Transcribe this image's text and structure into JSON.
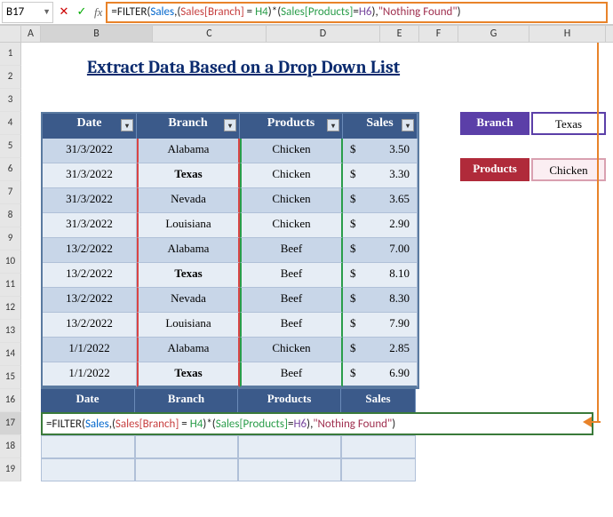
{
  "cellref": "B17",
  "formula": {
    "eq": "=",
    "fn": "FILTER",
    "p1": "(",
    "sales": "Sales",
    "c1": ",(",
    "branchcol": "Sales[Branch]",
    "eq2": " = ",
    "h4": "H4",
    "mid": ")*(",
    "prodcol": "Sales[Products]",
    "eq3": "=",
    "h6": "H6",
    "end": "),",
    "str": "\"Nothing Found\"",
    "close": ")"
  },
  "cols": [
    "A",
    "B",
    "C",
    "D",
    "E",
    "F",
    "G",
    "H"
  ],
  "rows": [
    "1",
    "2",
    "3",
    "4",
    "5",
    "6",
    "7",
    "8",
    "9",
    "10",
    "11",
    "12",
    "13",
    "14",
    "15",
    "16",
    "17",
    "18",
    "19"
  ],
  "title": "Extract Data Based on a Drop Down List",
  "headers": {
    "date": "Date",
    "branch": "Branch",
    "products": "Products",
    "sales": "Sales"
  },
  "data": [
    {
      "date": "31/3/2022",
      "branch": "Alabama",
      "product": "Chicken",
      "cur": "$",
      "sales": "3.50"
    },
    {
      "date": "31/3/2022",
      "branch": "Texas",
      "product": "Chicken",
      "cur": "$",
      "sales": "3.30",
      "bold": true
    },
    {
      "date": "31/3/2022",
      "branch": "Nevada",
      "product": "Chicken",
      "cur": "$",
      "sales": "3.65"
    },
    {
      "date": "31/3/2022",
      "branch": "Louisiana",
      "product": "Chicken",
      "cur": "$",
      "sales": "2.90"
    },
    {
      "date": "13/2/2022",
      "branch": "Alabama",
      "product": "Beef",
      "cur": "$",
      "sales": "7.00"
    },
    {
      "date": "13/2/2022",
      "branch": "Texas",
      "product": "Beef",
      "cur": "$",
      "sales": "8.10",
      "bold": true
    },
    {
      "date": "13/2/2022",
      "branch": "Nevada",
      "product": "Beef",
      "cur": "$",
      "sales": "8.30"
    },
    {
      "date": "13/2/2022",
      "branch": "Louisiana",
      "product": "Beef",
      "cur": "$",
      "sales": "7.90"
    },
    {
      "date": "1/1/2022",
      "branch": "Alabama",
      "product": "Chicken",
      "cur": "$",
      "sales": "2.85"
    },
    {
      "date": "1/1/2022",
      "branch": "Texas",
      "product": "Beef",
      "cur": "$",
      "sales": "6.90",
      "bold": true
    }
  ],
  "dd": {
    "branch_label": "Branch",
    "branch_val": "Texas",
    "prod_label": "Products",
    "prod_val": "Chicken"
  }
}
